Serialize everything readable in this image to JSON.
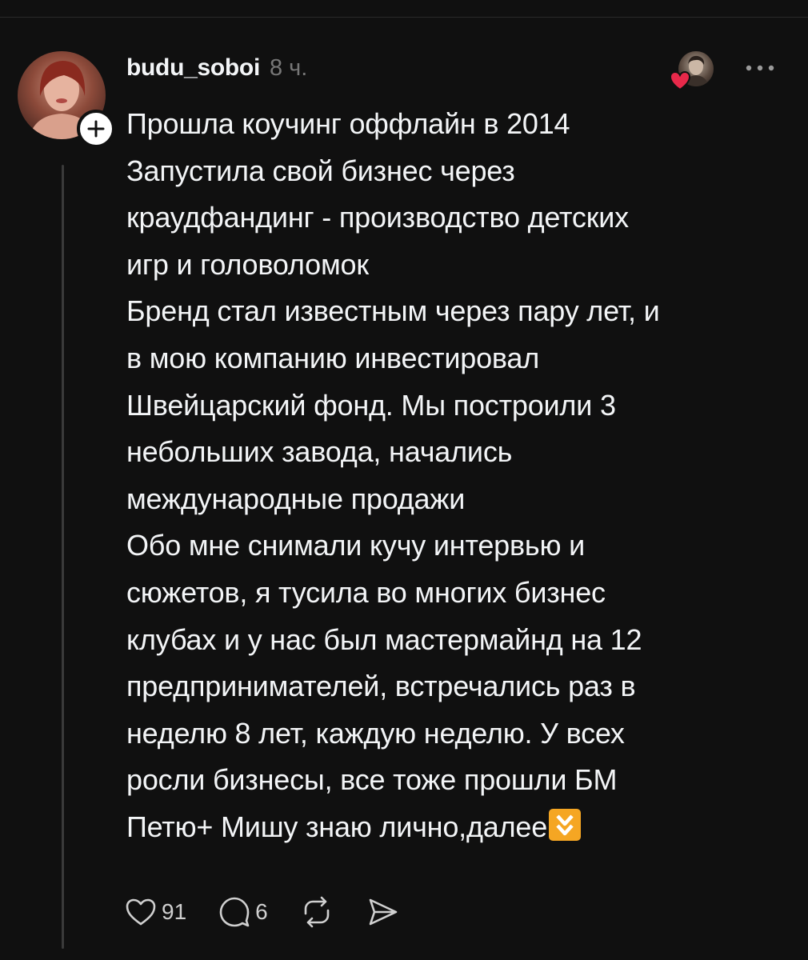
{
  "post": {
    "username": "budu_soboi",
    "timestamp": "8 ч.",
    "lines": [
      "Прошла коучинг оффлайн в 2014",
      "Запустила свой бизнес через",
      "краудфандинг - производство детских",
      "игр и головоломок",
      "Бренд стал известным через пару лет, и",
      "в мою компанию инвестировал",
      "Швейцарский фонд. Мы построили 3",
      "небольших завода, начались",
      "международные продажи",
      "Обо мне снимали кучу интервью и",
      "сюжетов, я тусила во многих бизнес",
      "клубах и у нас был мастермайнд на 12",
      "предпринимателей, встречались раз в",
      "неделю 8 лет, каждую неделю. У всех",
      "росли бизнесы, все тоже прошли БМ"
    ],
    "last_line": "Петю+ Мишу знаю лично,далее",
    "last_line_emoji": "double-down-arrow-emoji-icon",
    "likes_count": "91",
    "comments_count": "6"
  },
  "icons": {
    "follow": "plus-icon",
    "liker": "liker-avatar",
    "heart_badge": "red-heart-icon",
    "more": "ellipsis-icon",
    "like": "heart-outline-icon",
    "comment": "comment-bubble-icon",
    "repost": "repost-icon",
    "share": "send-icon"
  },
  "colors": {
    "background": "#101010",
    "text": "#f3f5f7",
    "muted": "#777777",
    "heart": "#e8294a",
    "emoji": "#f5a623"
  }
}
